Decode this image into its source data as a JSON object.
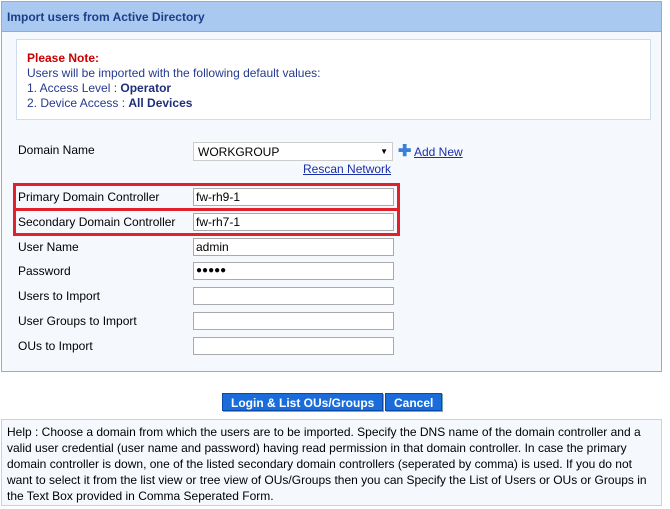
{
  "title": "Import users from Active Directory",
  "note": {
    "heading": "Please Note:",
    "intro": "Users will be imported with the following default values:",
    "item1_label": "1. Access Level : ",
    "item1_value": "Operator",
    "item2_label": "2. Device Access : ",
    "item2_value": "All Devices"
  },
  "form": {
    "domain_label": "Domain Name",
    "domain_value": "WORKGROUP",
    "add_new": "Add New",
    "rescan": "Rescan Network",
    "primary_label": "Primary Domain Controller",
    "primary_value": "fw-rh9-1",
    "secondary_label": "Secondary Domain Controller",
    "secondary_value": "fw-rh7-1",
    "user_label": "User Name",
    "user_value": "admin",
    "password_label": "Password",
    "password_value": "●●●●●",
    "users_label": "Users to Import",
    "users_value": "",
    "groups_label": "User Groups to Import",
    "groups_value": "",
    "ous_label": "OUs to Import",
    "ous_value": ""
  },
  "buttons": {
    "login": "Login & List OUs/Groups",
    "cancel": "Cancel"
  },
  "help": "Help : Choose a domain from which the users are to be imported. Specify the DNS name of the domain controller and a valid user credential (user name and password) having read permission in that domain controller. In case the primary domain controller is down, one of the listed secondary domain controllers (seperated by comma) is used. If you do not want to select it from the list view or tree view of OUs/Groups then you can Specify the List of Users or OUs or Groups in the Text Box provided in Comma Seperated Form."
}
